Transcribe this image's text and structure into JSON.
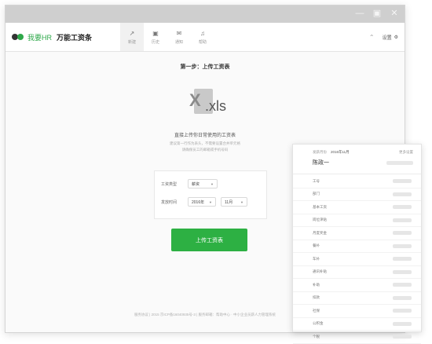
{
  "window": {
    "controls": [
      "—",
      "▣",
      "✕"
    ]
  },
  "brand": {
    "logo_text": "我要HR",
    "product": "万能工资条"
  },
  "nav": {
    "items": [
      {
        "icon": "↗",
        "label": "新建"
      },
      {
        "icon": "▣",
        "label": "历史"
      },
      {
        "icon": "✉",
        "label": "通知"
      },
      {
        "icon": "♫",
        "label": "帮助"
      }
    ]
  },
  "toolbar_right": {
    "minimize_icon": "⌃",
    "settings_label": "设置",
    "settings_icon": "⚙"
  },
  "main": {
    "step_title": "第一步：上传工资表",
    "file_icon_letter": "X",
    "file_icon_ext": ".xls",
    "description": "直接上传你日常使用的工资表",
    "hint_line1": "建议第一行作为表头，不需要设置合并单元格",
    "hint_line2": "请确保员工的邮箱或手机号码",
    "form": {
      "type_label": "工资类型",
      "type_value": "薪资",
      "date_label": "发放时间",
      "year_value": "2016年",
      "month_value": "11月"
    },
    "upload_button": "上传工资表",
    "footer": "服务协议 | 2015 京ICP备16040935号-3 | 服务邮箱：帮助中心 · 中小企业员薪人力管理系统"
  },
  "payslip": {
    "month_label": "发薪月份",
    "month_value": "2016年11月",
    "more_label": "更多设置",
    "employee_name": "陈政一",
    "rows": [
      "工号",
      "部门",
      "基本工资",
      "岗位津贴",
      "月度奖金",
      "餐补",
      "车补",
      "通讯补贴",
      "补助",
      "扣款",
      "社保",
      "公积金",
      "个税"
    ]
  },
  "colors": {
    "accent_green": "#2db043",
    "titlebar": "#cfcfcf"
  }
}
